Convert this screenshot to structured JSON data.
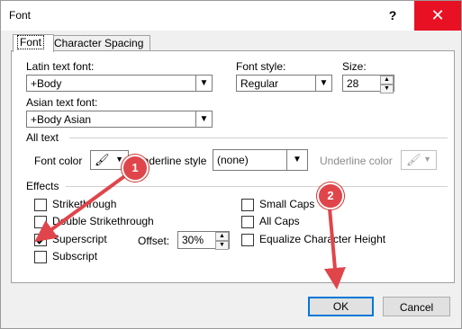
{
  "window": {
    "title": "Font",
    "help_label": "?",
    "close_label": "✕"
  },
  "tabs": [
    {
      "label": "Font"
    },
    {
      "label": "Character Spacing"
    }
  ],
  "latin_font": {
    "label": "Latin text font:",
    "value": "+Body"
  },
  "font_style": {
    "label": "Font style:",
    "value": "Regular"
  },
  "size": {
    "label": "Size:",
    "value": "28"
  },
  "asian_font": {
    "label": "Asian text font:",
    "value": "+Body Asian"
  },
  "all_text": {
    "section": "All text",
    "font_color_label": "Font color",
    "underline_style_label": "Underline style",
    "underline_style_value": "(none)",
    "underline_color_label": "Underline color"
  },
  "effects": {
    "section": "Effects",
    "left": [
      {
        "label": "Strikethrough",
        "checked": false
      },
      {
        "label": "Double Strikethrough",
        "checked": false
      },
      {
        "label": "Superscript",
        "checked": true
      },
      {
        "label": "Subscript",
        "checked": false
      }
    ],
    "offset_label": "Offset:",
    "offset_value": "30%",
    "right": [
      {
        "label": "Small Caps",
        "checked": false
      },
      {
        "label": "All Caps",
        "checked": false
      },
      {
        "label": "Equalize Character Height",
        "checked": false
      }
    ]
  },
  "buttons": {
    "ok": "OK",
    "cancel": "Cancel"
  },
  "annotations": {
    "badge1": "1",
    "badge2": "2",
    "color": "#e0454b"
  }
}
